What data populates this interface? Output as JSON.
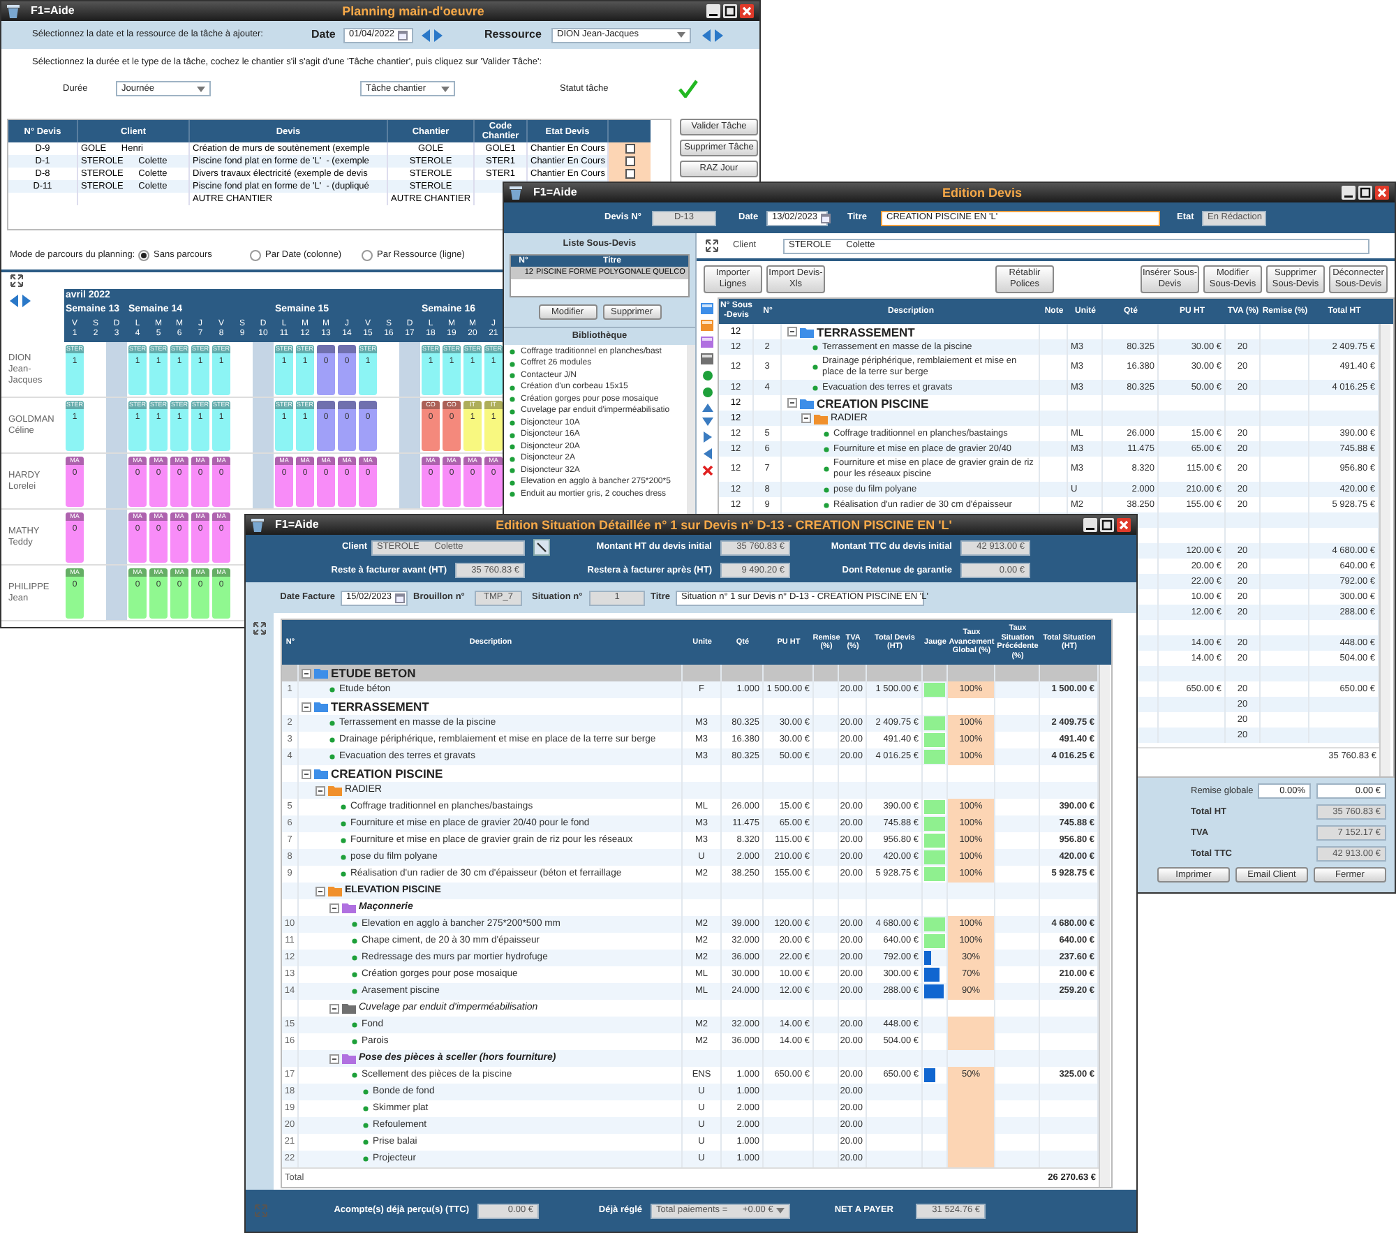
{
  "planning_window": {
    "help_label": "F1=Aide",
    "title": "Planning main-d'oeuvre",
    "date_prompt": "Sélectionnez la date et la ressource de la tâche à ajouter:",
    "date_label": "Date",
    "date": "01/04/2022",
    "resource_label": "Ressource",
    "resource": "DION Jean-Jacques",
    "task_prompt": "Sélectionnez la durée et le type de la tâche, cochez le chantier s'il s'agit d'une 'Tâche chantier', puis cliquez sur 'Valider Tâche':",
    "duration_label": "Durée",
    "duration": "Journée",
    "task_type": "Tâche chantier",
    "status_label": "Statut tâche",
    "status_ok": true,
    "table": {
      "columns": [
        "N° Devis",
        "Client",
        "Devis",
        "Chantier",
        "Code Chantier",
        "Etat Devis"
      ],
      "rows": [
        {
          "devis_no": "D-9",
          "client": "GOLE      Henri",
          "devis": "Création de murs de soutènement (exemple",
          "chantier": "GOLE",
          "code": "GOLE1",
          "etat": "Chantier En Cours",
          "checked": false
        },
        {
          "devis_no": "D-1",
          "client": "STEROLE      Colette",
          "devis": "Piscine fond plat en forme de 'L'  - (exemple",
          "chantier": "STEROLE",
          "code": "STER1",
          "etat": "Chantier En Cours",
          "checked": false
        },
        {
          "devis_no": "D-8",
          "client": "STEROLE      Colette",
          "devis": "Divers travaux électricité (exemple de devis",
          "chantier": "STEROLE",
          "code": "STER1",
          "etat": "Chantier En Cours",
          "checked": false
        },
        {
          "devis_no": "D-11",
          "client": "STEROLE      Colette",
          "devis": "Piscine fond plat en forme de 'L'  - (dupliqué",
          "chantier": "STEROLE"
        },
        {
          "devis": "AUTRE CHANTIER",
          "chantier": "AUTRE CHANTIER"
        }
      ]
    },
    "buttons": [
      "Valider Tâche",
      "Supprimer Tâche",
      "RAZ Jour"
    ],
    "mode_label": "Mode de parcours du planning:",
    "modes": [
      {
        "label": "Sans parcours",
        "selected": true
      },
      {
        "label": "Par Date (colonne)",
        "selected": false
      },
      {
        "label": "Par Ressource (ligne)",
        "selected": false
      }
    ],
    "grid": {
      "month": "avril 2022",
      "weeks": [
        {
          "label": "Semaine 13",
          "days": [
            {
              "letter": "V",
              "number": "1",
              "shaded": false
            },
            {
              "letter": "S",
              "number": "2",
              "shaded": false
            },
            {
              "letter": "D",
              "number": "3",
              "shaded": true
            }
          ]
        },
        {
          "label": "Semaine 14",
          "days": [
            {
              "letter": "L",
              "number": "4",
              "shaded": false
            },
            {
              "letter": "M",
              "number": "5",
              "shaded": false
            },
            {
              "letter": "M",
              "number": "6",
              "shaded": false
            },
            {
              "letter": "J",
              "number": "7",
              "shaded": false
            },
            {
              "letter": "V",
              "number": "8",
              "shaded": false
            },
            {
              "letter": "S",
              "number": "9",
              "shaded": false
            },
            {
              "letter": "D",
              "number": "10",
              "shaded": true
            }
          ]
        },
        {
          "label": "Semaine 15",
          "days": [
            {
              "letter": "L",
              "number": "11",
              "shaded": false
            },
            {
              "letter": "M",
              "number": "12",
              "shaded": false
            },
            {
              "letter": "M",
              "number": "13",
              "shaded": false
            },
            {
              "letter": "J",
              "number": "14",
              "shaded": false
            },
            {
              "letter": "V",
              "number": "15",
              "shaded": false
            },
            {
              "letter": "S",
              "number": "16",
              "shaded": false
            },
            {
              "letter": "D",
              "number": "17",
              "shaded": true
            }
          ]
        },
        {
          "label": "Semaine 16",
          "days": [
            {
              "letter": "L",
              "number": "18",
              "shaded": false
            },
            {
              "letter": "M",
              "number": "19",
              "shaded": false
            },
            {
              "letter": "M",
              "number": "20",
              "shaded": false
            },
            {
              "letter": "J",
              "number": "21",
              "shaded": false
            }
          ]
        }
      ],
      "resources": [
        {
          "name": "DION",
          "first_name": "Jean-Jacques",
          "cells": [
            {
              "tag": "STER",
              "value": "1",
              "color": "#8cf4f4"
            },
            null,
            null,
            {
              "tag": "STER",
              "value": "1",
              "color": "#8cf4f4"
            },
            {
              "tag": "STER",
              "value": "1",
              "color": "#8cf4f4"
            },
            {
              "tag": "STER",
              "value": "1",
              "color": "#8cf4f4"
            },
            {
              "tag": "STER",
              "value": "1",
              "color": "#8cf4f4"
            },
            {
              "tag": "STER",
              "value": "1",
              "color": "#8cf4f4"
            },
            null,
            null,
            {
              "tag": "STER",
              "value": "1",
              "color": "#8cf4f4"
            },
            {
              "tag": "STER",
              "value": "1",
              "color": "#8cf4f4"
            },
            {
              "value": "0",
              "color": "#a0a0f8"
            },
            {
              "value": "0",
              "color": "#a0a0f8"
            },
            {
              "tag": "STER",
              "value": "1",
              "color": "#8cf4f4"
            },
            null,
            null,
            {
              "tag": "STER",
              "value": "1",
              "color": "#8cf4f4"
            },
            {
              "tag": "STER",
              "value": "1",
              "color": "#8cf4f4"
            },
            {
              "tag": "STER",
              "value": "1",
              "color": "#8cf4f4"
            },
            {
              "tag": "STER",
              "value": "1",
              "color": "#8cf4f4"
            }
          ]
        },
        {
          "name": "GOLDMAN",
          "first_name": "Céline",
          "cells": [
            {
              "tag": "STER",
              "value": "1",
              "color": "#8cf4f4"
            },
            null,
            null,
            {
              "tag": "STER",
              "value": "1",
              "color": "#8cf4f4"
            },
            {
              "tag": "STER",
              "value": "1",
              "color": "#8cf4f4"
            },
            {
              "tag": "STER",
              "value": "1",
              "color": "#8cf4f4"
            },
            {
              "tag": "STER",
              "value": "1",
              "color": "#8cf4f4"
            },
            {
              "tag": "STER",
              "value": "1",
              "color": "#8cf4f4"
            },
            null,
            null,
            {
              "tag": "STER",
              "value": "1",
              "color": "#8cf4f4"
            },
            {
              "tag": "STER",
              "value": "1",
              "color": "#8cf4f4"
            },
            {
              "value": "0",
              "color": "#a0a0f8"
            },
            {
              "value": "0",
              "color": "#a0a0f8"
            },
            {
              "value": "0",
              "color": "#a0a0f8"
            },
            null,
            null,
            {
              "tag": "CO",
              "value": "0",
              "color": "#f4897c"
            },
            {
              "tag": "CO",
              "value": "0",
              "color": "#f4897c"
            },
            {
              "tag": "IT",
              "value": "1",
              "color": "#f8f880"
            },
            {
              "tag": "IT",
              "value": "1",
              "color": "#f8f880"
            }
          ]
        },
        {
          "name": "HARDY",
          "first_name": "Lorelei",
          "cells": [
            {
              "tag": "MA",
              "value": "0",
              "color": "#f88cf8"
            },
            null,
            null,
            {
              "tag": "MA",
              "value": "0",
              "color": "#f88cf8"
            },
            {
              "tag": "MA",
              "value": "0",
              "color": "#f88cf8"
            },
            {
              "tag": "MA",
              "value": "0",
              "color": "#f88cf8"
            },
            {
              "tag": "MA",
              "value": "0",
              "color": "#f88cf8"
            },
            {
              "tag": "MA",
              "value": "0",
              "color": "#f88cf8"
            },
            null,
            null,
            {
              "tag": "MA",
              "value": "0",
              "color": "#f88cf8"
            },
            {
              "tag": "MA",
              "value": "0",
              "color": "#f88cf8"
            },
            {
              "tag": "MA",
              "value": "0",
              "color": "#f88cf8"
            },
            {
              "tag": "MA",
              "value": "0",
              "color": "#f88cf8"
            },
            {
              "tag": "MA",
              "value": "0",
              "color": "#f88cf8"
            },
            null,
            null,
            {
              "tag": "MA",
              "value": "0",
              "color": "#f88cf8"
            },
            {
              "tag": "MA",
              "value": "0",
              "color": "#f88cf8"
            },
            {
              "tag": "MA",
              "value": "0",
              "color": "#f88cf8"
            },
            {
              "tag": "MA",
              "value": "0",
              "color": "#f88cf8"
            }
          ]
        },
        {
          "name": "MATHY",
          "first_name": "Teddy",
          "cells": [
            {
              "tag": "MA",
              "value": "0",
              "color": "#f88cf8"
            },
            null,
            null,
            {
              "tag": "MA",
              "value": "0",
              "color": "#f88cf8"
            },
            {
              "tag": "MA",
              "value": "0",
              "color": "#f88cf8"
            },
            {
              "tag": "MA",
              "value": "0",
              "color": "#f88cf8"
            },
            {
              "tag": "MA",
              "value": "0",
              "color": "#f88cf8"
            },
            {
              "tag": "MA",
              "value": "0",
              "color": "#f88cf8"
            }
          ]
        },
        {
          "name": "PHILIPPE",
          "first_name": "Jean",
          "cells": [
            {
              "tag": "MA",
              "value": "0",
              "color": "#90f890"
            },
            null,
            null,
            {
              "tag": "MA",
              "value": "0",
              "color": "#90f890"
            },
            {
              "tag": "MA",
              "value": "0",
              "color": "#90f890"
            },
            {
              "tag": "MA",
              "value": "0",
              "color": "#90f890"
            },
            {
              "tag": "MA",
              "value": "0",
              "color": "#90f890"
            },
            {
              "tag": "MA",
              "value": "0",
              "color": "#90f890"
            }
          ]
        }
      ]
    }
  },
  "devis_window": {
    "help_label": "F1=Aide",
    "title": "Edition Devis",
    "devis_no_label": "Devis N°",
    "devis_no": "D-13",
    "date_label": "Date",
    "date": "13/02/2023",
    "titre_label": "Titre",
    "titre": "CREATION PISCINE EN 'L'",
    "etat_label": "Etat",
    "etat": "En Rédaction",
    "sous_devis_panel": {
      "title": "Liste Sous-Devis",
      "columns": [
        "N°",
        "Titre"
      ],
      "rows": [
        {
          "no": "12",
          "titre": "PISCINE FORME POLYGONALE QUELCO",
          "selected": true
        }
      ],
      "buttons": [
        "Modifier",
        "Supprimer"
      ]
    },
    "library": {
      "title": "Bibliothèque",
      "items": [
        "Coffrage traditionnel en planches/bast",
        "Coffret 26 modules",
        "Contacteur J/N",
        "Création d'un corbeau  15x15",
        "Création gorges pour pose mosaique",
        "Cuvelage par enduit d'imperméabilisatio",
        "Disjoncteur 10A",
        "Disjoncteur 16A",
        "Disjoncteur 20A",
        "Disjoncteur 2A",
        "Disjoncteur 32A",
        "Elevation en agglo à bancher 275*200*5",
        "Enduit au mortier gris, 2 couches dress"
      ]
    },
    "client_label": "Client",
    "client": "STEROLE      Colette",
    "toolbar": [
      "Importer Lignes",
      "Import Devis-Xls",
      "Rétablir Polices",
      "Insérer Sous-Devis",
      "Modifier Sous-Devis",
      "Supprimer Sous-Devis",
      "Déconnecter Sous-Devis"
    ],
    "table": {
      "columns": [
        "N° Sous -Devis",
        "N°",
        "Description",
        "Note",
        "Unité",
        "Qté",
        "PU HT",
        "TVA (%)",
        "Remise (%)",
        "Total HT"
      ],
      "rows": [
        {
          "kind": "group",
          "sous_devis": "12",
          "label": "TERRASSEMENT",
          "color": "#3d8ee8",
          "children": [
            {
              "kind": "item",
              "sous_devis": "12",
              "no": "2",
              "description": "Terrassement en masse de la piscine",
              "unite": "M3",
              "qte": "80.325",
              "pu_ht": "30.00 €",
              "tva": "20",
              "total_ht": "2 409.75 €"
            },
            {
              "kind": "item",
              "sous_devis": "12",
              "no": "3",
              "description": "Drainage périphérique, remblaiement et mise en place de la terre sur berge",
              "unite": "M3",
              "qte": "16.380",
              "pu_ht": "30.00 €",
              "tva": "20",
              "total_ht": "491.40 €"
            },
            {
              "kind": "item",
              "sous_devis": "12",
              "no": "4",
              "description": "Evacuation des terres et gravats",
              "unite": "M3",
              "qte": "80.325",
              "pu_ht": "50.00 €",
              "tva": "20",
              "total_ht": "4 016.25 €"
            }
          ]
        },
        {
          "kind": "group",
          "sous_devis": "12",
          "label": "CREATION PISCINE",
          "color": "#3d8ee8",
          "children": [
            {
              "kind": "group",
              "sous_devis": "12",
              "label": "RADIER",
              "color": "#f0902c",
              "children": [
                {
                  "kind": "item",
                  "sous_devis": "12",
                  "no": "5",
                  "description": "Coffrage traditionnel en planches/bastaings",
                  "unite": "ML",
                  "qte": "26.000",
                  "pu_ht": "15.00 €",
                  "tva": "20",
                  "total_ht": "390.00 €"
                },
                {
                  "kind": "item",
                  "sous_devis": "12",
                  "no": "6",
                  "description": "Fourniture et mise en place de gravier 20/40",
                  "unite": "M3",
                  "qte": "11.475",
                  "pu_ht": "65.00 €",
                  "tva": "20",
                  "total_ht": "745.88 €"
                },
                {
                  "kind": "item",
                  "sous_devis": "12",
                  "no": "7",
                  "description": "Fourniture et mise en place de gravier grain de riz pour les réseaux piscine",
                  "unite": "M3",
                  "qte": "8.320",
                  "pu_ht": "115.00 €",
                  "tva": "20",
                  "total_ht": "956.80 €"
                },
                {
                  "kind": "item",
                  "sous_devis": "12",
                  "no": "8",
                  "description": "pose du film polyane",
                  "unite": "U",
                  "qte": "2.000",
                  "pu_ht": "210.00 €",
                  "tva": "20",
                  "total_ht": "420.00 €"
                },
                {
                  "kind": "item",
                  "sous_devis": "12",
                  "no": "9",
                  "description": "Réalisation d'un radier de 30 cm d'épaisseur",
                  "unite": "M2",
                  "qte": "38.250",
                  "pu_ht": "155.00 €",
                  "tva": "20",
                  "total_ht": "5 928.75 €"
                }
              ]
            }
          ]
        }
      ],
      "more_rows": [
        {
          "kind": "blank"
        },
        {
          "kind": "blank"
        },
        {
          "kind": "line",
          "pu_ht": "120.00 €",
          "tva": "20",
          "total_ht": "4 680.00 €"
        },
        {
          "kind": "line",
          "pu_ht": "20.00 €",
          "tva": "20",
          "total_ht": "640.00 €"
        },
        {
          "kind": "line",
          "pu_ht": "22.00 €",
          "tva": "20",
          "total_ht": "792.00 €"
        },
        {
          "kind": "line",
          "pu_ht": "10.00 €",
          "tva": "20",
          "total_ht": "300.00 €"
        },
        {
          "kind": "line",
          "pu_ht": "12.00 €",
          "tva": "20",
          "total_ht": "288.00 €"
        },
        {
          "kind": "blank"
        },
        {
          "kind": "line",
          "pu_ht": "14.00 €",
          "tva": "20",
          "total_ht": "448.00 €"
        },
        {
          "kind": "line",
          "pu_ht": "14.00 €",
          "tva": "20",
          "total_ht": "504.00 €"
        },
        {
          "kind": "blank"
        },
        {
          "kind": "line",
          "pu_ht": "650.00 €",
          "tva": "20",
          "total_ht": "650.00 €"
        },
        {
          "kind": "line",
          "tva": "20"
        },
        {
          "kind": "line",
          "tva": "20"
        },
        {
          "kind": "line",
          "tva": "20"
        }
      ],
      "total": "35 760.83 €"
    },
    "totals": {
      "remise_label": "Remise globale",
      "remise_pct": "0.00%",
      "remise_amount": "0.00 €",
      "total_ht_label": "Total HT",
      "total_ht": "35 760.83 €",
      "tva_label": "TVA",
      "tva": "7 152.17 €",
      "ttc_label": "Total TTC",
      "ttc": "42 913.00 €"
    },
    "buttons": [
      "Imprimer",
      "Email Client",
      "Fermer"
    ]
  },
  "situation_window": {
    "help_label": "F1=Aide",
    "title": "Edition Situation Détaillée n° 1 sur Devis n° D-13 - CREATION PISCINE EN 'L'",
    "client_label": "Client",
    "client": "STEROLE      Colette",
    "montant_ht_label": "Montant HT du devis initial",
    "montant_ht": "35 760.83 €",
    "montant_ttc_label": "Montant TTC du devis initial",
    "montant_ttc": "42 913.00 €",
    "reste_avant_label": "Reste à facturer avant (HT)",
    "reste_avant": "35 760.83 €",
    "reste_apres_label": "Restera à facturer après (HT)",
    "reste_apres": "9 490.20 €",
    "retenue_label": "Dont Retenue de garantie",
    "retenue": "0.00 €",
    "date_label": "Date Facture",
    "date": "15/02/2023",
    "brouillon_label": "Brouillon n°",
    "brouillon": "TMP_7",
    "situation_label": "Situation n°",
    "situation": "1",
    "titre_label": "Titre",
    "titre": "Situation n° 1 sur Devis n° D-13 - CREATION PISCINE EN 'L'",
    "table": {
      "columns": [
        "N°",
        "Description",
        "Unite",
        "Qté",
        "PU HT",
        "Remise (%)",
        "TVA (%)",
        "Total Devis (HT)",
        "Jauge",
        "Taux Avancement Global (%)",
        "Taux Situation Précédente (%)",
        "Total Situation (HT)"
      ],
      "rows": [
        {
          "kind": "group",
          "label": "ETUDE BETON",
          "color": "#3d8ee8",
          "bold": true,
          "selected": true,
          "children": [
            {
              "kind": "item",
              "no": "1",
              "description": "Etude béton",
              "unite": "F",
              "qte": "1.000",
              "pu_ht": "1 500.00 €",
              "tva": "20.00",
              "total_devis": "1 500.00 €",
              "level": 1,
              "advance": "100%",
              "total_situation": "1 500.00 €"
            }
          ]
        },
        {
          "kind": "group",
          "label": "TERRASSEMENT",
          "color": "#3d8ee8",
          "bold": true,
          "selected": false,
          "children": [
            {
              "kind": "item",
              "no": "2",
              "description": "Terrassement en masse de la piscine",
              "unite": "M3",
              "qte": "80.325",
              "pu_ht": "30.00 €",
              "tva": "20.00",
              "total_devis": "2 409.75 €",
              "level": 1,
              "advance": "100%",
              "total_situation": "2 409.75 €"
            },
            {
              "kind": "item",
              "no": "3",
              "description": "Drainage périphérique, remblaiement et mise en place de la terre sur berge",
              "unite": "M3",
              "qte": "16.380",
              "pu_ht": "30.00 €",
              "tva": "20.00",
              "total_devis": "491.40 €",
              "level": 1,
              "advance": "100%",
              "total_situation": "491.40 €"
            },
            {
              "kind": "item",
              "no": "4",
              "description": "Evacuation des terres et gravats",
              "unite": "M3",
              "qte": "80.325",
              "pu_ht": "50.00 €",
              "tva": "20.00",
              "total_devis": "4 016.25 €",
              "level": 1,
              "advance": "100%",
              "total_situation": "4 016.25 €"
            }
          ]
        },
        {
          "kind": "group",
          "label": "CREATION PISCINE",
          "color": "#3d8ee8",
          "bold": true,
          "selected": false,
          "children": [
            {
              "kind": "group",
              "label": "RADIER",
              "color": "#f0902c",
              "bold": false,
              "selected": false,
              "children": [
                {
                  "kind": "item",
                  "no": "5",
                  "description": "Coffrage traditionnel en planches/bastaings",
                  "unite": "ML",
                  "qte": "26.000",
                  "pu_ht": "15.00 €",
                  "tva": "20.00",
                  "total_devis": "390.00 €",
                  "level": 1,
                  "advance": "100%",
                  "total_situation": "390.00 €"
                },
                {
                  "kind": "item",
                  "no": "6",
                  "description": "Fourniture et mise en place de gravier 20/40 pour le fond",
                  "unite": "M3",
                  "qte": "11.475",
                  "pu_ht": "65.00 €",
                  "tva": "20.00",
                  "total_devis": "745.88 €",
                  "level": 1,
                  "advance": "100%",
                  "total_situation": "745.88 €"
                },
                {
                  "kind": "item",
                  "no": "7",
                  "description": "Fourniture et mise en place de gravier grain de riz pour les réseaux",
                  "unite": "M3",
                  "qte": "8.320",
                  "pu_ht": "115.00 €",
                  "tva": "20.00",
                  "total_devis": "956.80 €",
                  "level": 1,
                  "advance": "100%",
                  "total_situation": "956.80 €"
                },
                {
                  "kind": "item",
                  "no": "8",
                  "description": "pose du film polyane",
                  "unite": "U",
                  "qte": "2.000",
                  "pu_ht": "210.00 €",
                  "tva": "20.00",
                  "total_devis": "420.00 €",
                  "level": 1,
                  "advance": "100%",
                  "total_situation": "420.00 €"
                },
                {
                  "kind": "item",
                  "no": "9",
                  "description": "Réalisation d'un radier de 30 cm d'épaisseur (béton et ferraillage",
                  "unite": "M2",
                  "qte": "38.250",
                  "pu_ht": "155.00 €",
                  "tva": "20.00",
                  "total_devis": "5 928.75 €",
                  "level": 1,
                  "advance": "100%",
                  "total_situation": "5 928.75 €"
                }
              ]
            },
            {
              "kind": "group",
              "label": "ELEVATION PISCINE",
              "color": "#f0902c",
              "bold": true,
              "selected": false,
              "children": [
                {
                  "kind": "group",
                  "label": "Maçonnerie",
                  "color": "#b070e0",
                  "bold": true,
                  "selected": false,
                  "children": [
                    {
                      "kind": "item",
                      "no": "10",
                      "description": "Elevation en agglo à bancher 275*200*500 mm",
                      "unite": "M2",
                      "qte": "39.000",
                      "pu_ht": "120.00 €",
                      "tva": "20.00",
                      "total_devis": "4 680.00 €",
                      "level": 1,
                      "advance": "100%",
                      "total_situation": "4 680.00 €"
                    },
                    {
                      "kind": "item",
                      "no": "11",
                      "description": "Chape ciment, de 20 à 30 mm d'épaisseur",
                      "unite": "M2",
                      "qte": "32.000",
                      "pu_ht": "20.00 €",
                      "tva": "20.00",
                      "total_devis": "640.00 €",
                      "level": 1,
                      "advance": "100%",
                      "total_situation": "640.00 €"
                    },
                    {
                      "kind": "item",
                      "no": "12",
                      "description": "Redressage des murs par mortier hydrofuge",
                      "unite": "M2",
                      "qte": "36.000",
                      "pu_ht": "22.00 €",
                      "tva": "20.00",
                      "total_devis": "792.00 €",
                      "level": 0.3,
                      "advance": "30%",
                      "total_situation": "237.60 €"
                    },
                    {
                      "kind": "item",
                      "no": "13",
                      "description": "Création gorges pour pose mosaique",
                      "unite": "ML",
                      "qte": "30.000",
                      "pu_ht": "10.00 €",
                      "tva": "20.00",
                      "total_devis": "300.00 €",
                      "level": 0.7,
                      "advance": "70%",
                      "total_situation": "210.00 €"
                    },
                    {
                      "kind": "item",
                      "no": "14",
                      "description": "Arasement piscine",
                      "unite": "ML",
                      "qte": "24.000",
                      "pu_ht": "12.00 €",
                      "tva": "20.00",
                      "total_devis": "288.00 €",
                      "level": 0.9,
                      "advance": "90%",
                      "total_situation": "259.20 €"
                    }
                  ]
                },
                {
                  "kind": "group",
                  "label": "Cuvelage par enduit d'imperméabilisation",
                  "color": "#707070",
                  "bold": false,
                  "selected": false,
                  "children": [
                    {
                      "kind": "item",
                      "no": "15",
                      "description": "Fond",
                      "unite": "M2",
                      "qte": "32.000",
                      "pu_ht": "14.00 €",
                      "tva": "20.00",
                      "total_devis": "448.00 €"
                    },
                    {
                      "kind": "item",
                      "no": "16",
                      "description": "Parois",
                      "unite": "M2",
                      "qte": "36.000",
                      "pu_ht": "14.00 €",
                      "tva": "20.00",
                      "total_devis": "504.00 €"
                    }
                  ]
                },
                {
                  "kind": "group",
                  "label": "Pose des pièces à sceller (hors fourniture)",
                  "color": "#b070e0",
                  "bold": true,
                  "selected": false,
                  "children": [
                    {
                      "kind": "item",
                      "no": "17",
                      "description": "Scellement des pièces de la piscine",
                      "unite": "ENS",
                      "qte": "1.000",
                      "pu_ht": "650.00 €",
                      "tva": "20.00",
                      "total_devis": "650.00 €",
                      "level": 0.5,
                      "advance": "50%",
                      "total_situation": "325.00 €",
                      "children": [
                        {
                          "kind": "item",
                          "no": "18",
                          "description": "Bonde de fond",
                          "unite": "U",
                          "qte": "1.000",
                          "tva": "20.00"
                        },
                        {
                          "kind": "item",
                          "no": "19",
                          "description": "Skimmer plat",
                          "unite": "U",
                          "qte": "2.000",
                          "tva": "20.00"
                        },
                        {
                          "kind": "item",
                          "no": "20",
                          "description": "Refoulement",
                          "unite": "U",
                          "qte": "2.000",
                          "tva": "20.00"
                        },
                        {
                          "kind": "item",
                          "no": "21",
                          "description": "Prise balai",
                          "unite": "U",
                          "qte": "1.000",
                          "tva": "20.00"
                        },
                        {
                          "kind": "item",
                          "no": "22",
                          "description": "Projecteur",
                          "unite": "U",
                          "qte": "1.000",
                          "tva": "20.00"
                        }
                      ]
                    }
                  ]
                }
              ]
            }
          ]
        }
      ],
      "total_label": "Total",
      "total": "26 270.63 €"
    },
    "acompte_label": "Acompte(s) déjà perçu(s) (TTC)",
    "acompte": "0.00 €",
    "deja_regle_label": "Déjà réglé",
    "deja_regle": "Total paiements =      +0.00 €",
    "net_label": "NET A PAYER",
    "net": "31 524.76 €"
  }
}
